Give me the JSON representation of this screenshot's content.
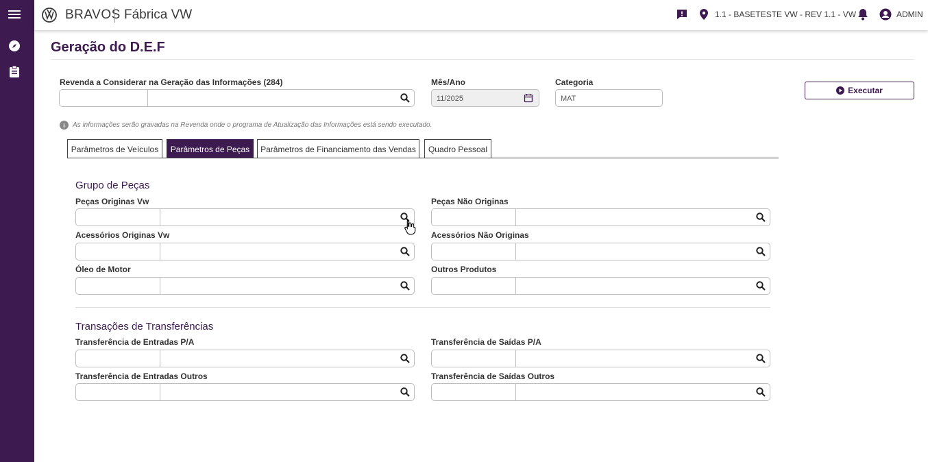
{
  "app": {
    "brand": "BRAVOS",
    "subtitle": "Fábrica VW"
  },
  "sidebar": {
    "items": [
      "menu-icon",
      "compass-icon",
      "clipboard-icon"
    ]
  },
  "topbar": {
    "location": "1.1 - BASETESTE VW - REV 1.1 - VW",
    "user": "ADMIN"
  },
  "page": {
    "title": "Geração do D.E.F"
  },
  "header_form": {
    "revenda_label": "Revenda a Considerar na Geração das Informações (284)",
    "mesano_label": "Mês/Ano",
    "mesano_value": "11/2025",
    "categoria_label": "Categoria",
    "categoria_value": "MAT",
    "execute_label": "Executar"
  },
  "info_text": "As informações serão gravadas na Revenda onde o programa de Atualização das Informações está sendo executado.",
  "tabs": [
    {
      "label": "Parâmetros de Veículos",
      "active": false
    },
    {
      "label": "Parâmetros de Peças",
      "active": true
    },
    {
      "label": "Parâmetros de Financiamento das Vendas",
      "active": false
    },
    {
      "label": "Quadro Pessoal",
      "active": false
    }
  ],
  "grupo_pecas": {
    "title": "Grupo de Peças",
    "fields": {
      "pecas_originais_vw": "Peças Originas Vw",
      "pecas_nao_originais": "Peças Não Originas",
      "acessorios_originais_vw": "Acessórios Originas Vw",
      "acessorios_nao_originais": "Acessórios Não Originas",
      "oleo_motor": "Óleo de Motor",
      "outros_produtos": "Outros Produtos"
    }
  },
  "transacoes": {
    "title": "Transações de Transferências",
    "fields": {
      "entradas_pa": "Transferência de Entradas P/A",
      "saidas_pa": "Transferência de Saídas P/A",
      "entradas_outros": "Transferência de Entradas Outros",
      "saidas_outros": "Transferência de Saídas Outros"
    }
  },
  "colors": {
    "primary": "#3d1a4f",
    "border": "#bdbdbd"
  }
}
